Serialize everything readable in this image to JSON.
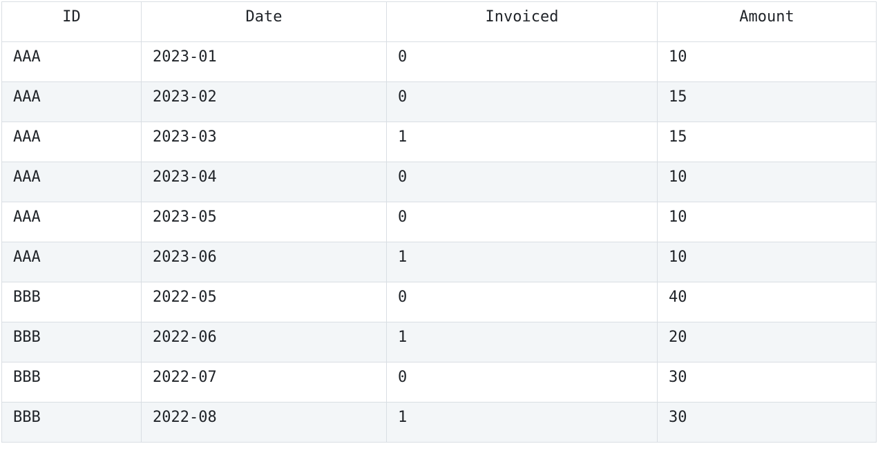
{
  "table": {
    "columns": [
      "ID",
      "Date",
      "Invoiced",
      "Amount"
    ],
    "rows": [
      [
        "AAA",
        "2023-01",
        "0",
        "10"
      ],
      [
        "AAA",
        "2023-02",
        "0",
        "15"
      ],
      [
        "AAA",
        "2023-03",
        "1",
        "15"
      ],
      [
        "AAA",
        "2023-04",
        "0",
        "10"
      ],
      [
        "AAA",
        "2023-05",
        "0",
        "10"
      ],
      [
        "AAA",
        "2023-06",
        "1",
        "10"
      ],
      [
        "BBB",
        "2022-05",
        "0",
        "40"
      ],
      [
        "BBB",
        "2022-06",
        "1",
        "20"
      ],
      [
        "BBB",
        "2022-07",
        "0",
        "30"
      ],
      [
        "BBB",
        "2022-08",
        "1",
        "30"
      ]
    ]
  },
  "colors": {
    "border": "#d9dee3",
    "row_alt": "#f3f6f8",
    "text": "#1f2328"
  }
}
